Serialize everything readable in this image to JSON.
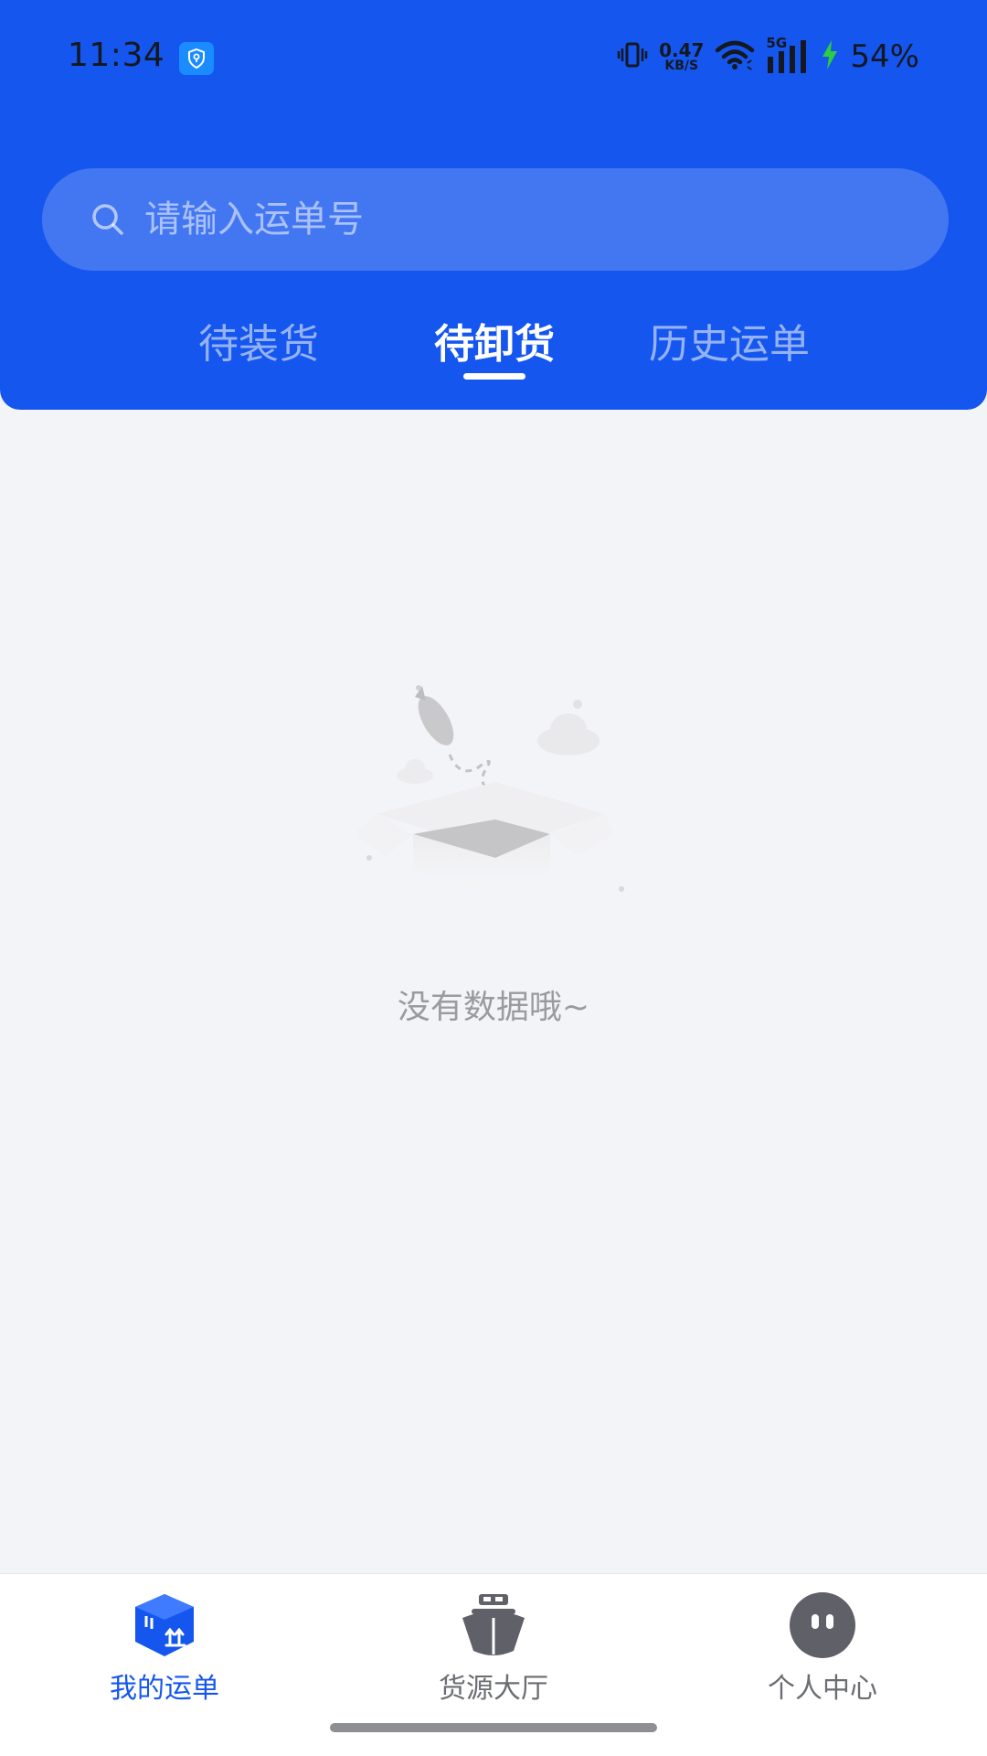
{
  "status_bar": {
    "time": "11:34",
    "net_speed_value": "0.47",
    "net_speed_unit": "KB/S",
    "network_label": "5G",
    "battery_percent": "54%",
    "icons": [
      "shield-app-icon",
      "vibrate-icon",
      "wifi-icon",
      "signal-icon",
      "charging-icon"
    ]
  },
  "search": {
    "placeholder": "请输入运单号",
    "value": ""
  },
  "tabs": [
    {
      "label": "待装货",
      "active": false
    },
    {
      "label": "待卸货",
      "active": true
    },
    {
      "label": "历史运单",
      "active": false
    }
  ],
  "empty_state": {
    "message": "没有数据哦~"
  },
  "bottom_nav": [
    {
      "label": "我的运单",
      "icon": "waybill-box-icon",
      "active": true
    },
    {
      "label": "货源大厅",
      "icon": "cargo-ship-icon",
      "active": false
    },
    {
      "label": "个人中心",
      "icon": "profile-face-icon",
      "active": false
    }
  ],
  "colors": {
    "primary": "#1556ee",
    "background": "#f3f4f7",
    "inactive_text": "#6b6d72",
    "charging_green": "#2ecc40"
  }
}
